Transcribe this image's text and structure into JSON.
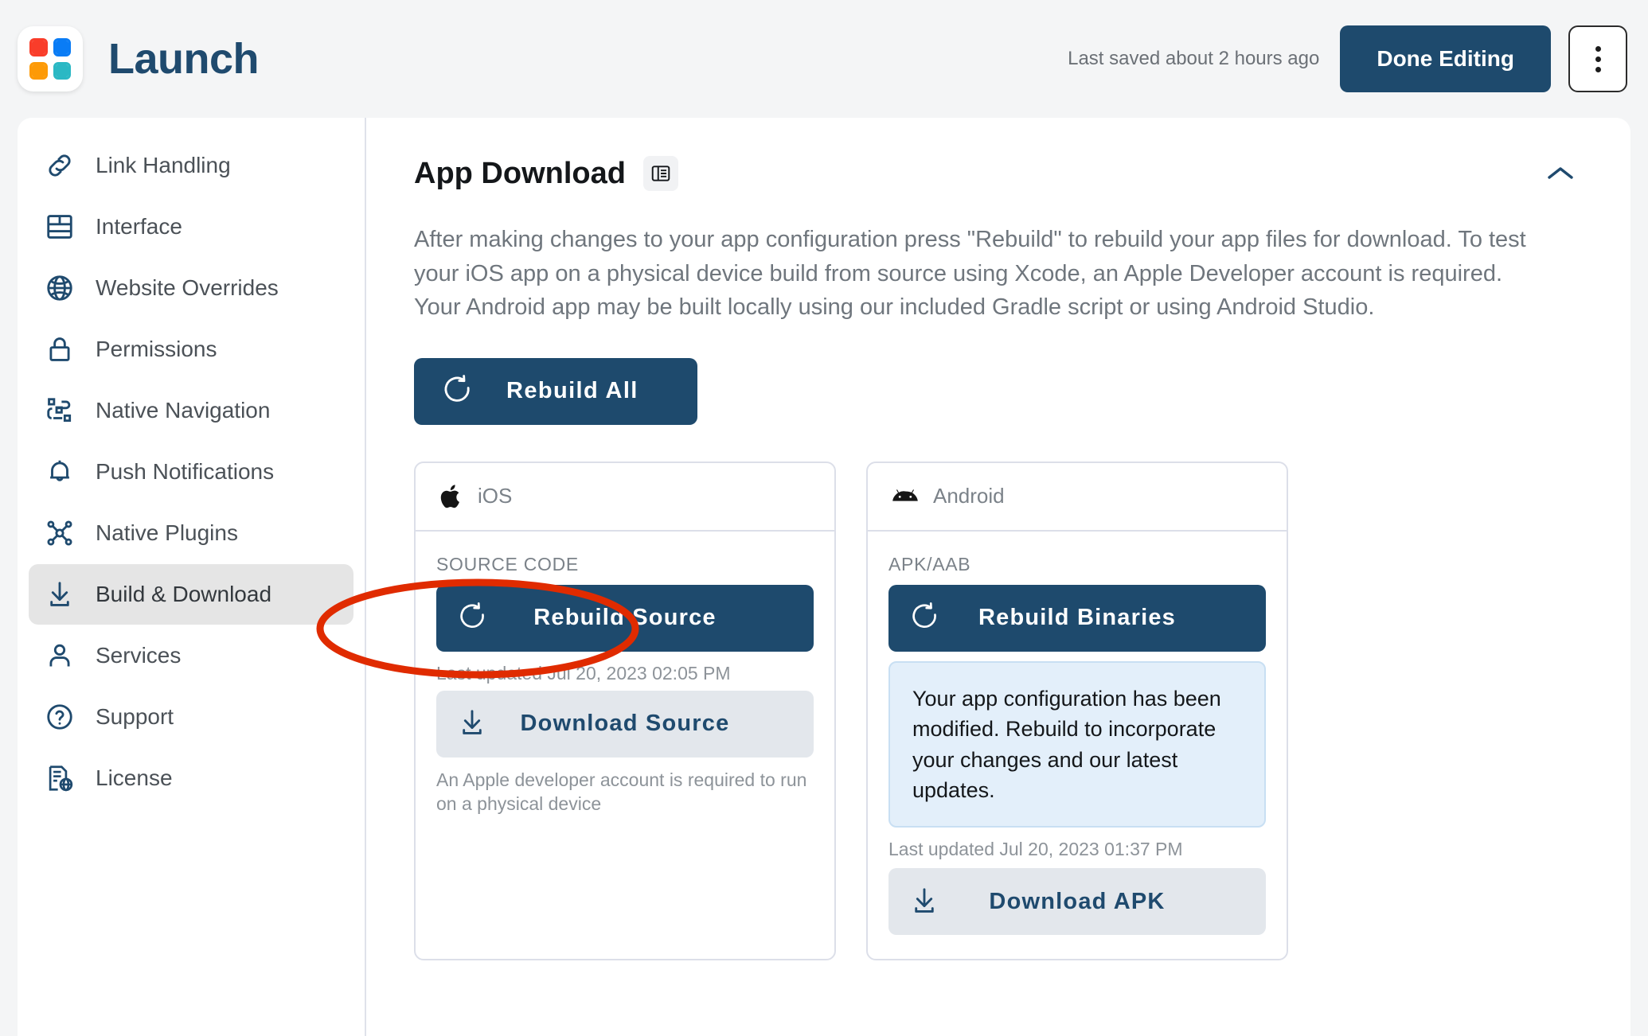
{
  "brand": {
    "name": "Launch",
    "logo_colors": [
      "#f93d2a",
      "#0a7cf5",
      "#fd9a07",
      "#2bb8c4"
    ]
  },
  "topbar": {
    "saved_status": "Last saved about 2 hours ago",
    "done_editing_label": "Done Editing",
    "overflow_menu_label": "More options"
  },
  "sidebar": {
    "items": [
      {
        "label": "Link Handling",
        "icon": "link-icon",
        "active": false
      },
      {
        "label": "Interface",
        "icon": "layout-icon",
        "active": false
      },
      {
        "label": "Website Overrides",
        "icon": "globe-icon",
        "active": false
      },
      {
        "label": "Permissions",
        "icon": "lock-icon",
        "active": false
      },
      {
        "label": "Native Navigation",
        "icon": "navigation-nodes-icon",
        "active": false
      },
      {
        "label": "Push Notifications",
        "icon": "bell-icon",
        "active": false
      },
      {
        "label": "Native Plugins",
        "icon": "plugins-nodes-icon",
        "active": false
      },
      {
        "label": "Build & Download",
        "icon": "download-icon",
        "active": true
      },
      {
        "label": "Services",
        "icon": "user-icon",
        "active": false
      },
      {
        "label": "Support",
        "icon": "question-circle-icon",
        "active": false
      },
      {
        "label": "License",
        "icon": "license-document-icon",
        "active": false
      }
    ]
  },
  "section": {
    "title": "App Download",
    "doc_icon": "panel-docs-icon",
    "collapse_icon": "chevron-up-icon",
    "description": "After making changes to your app configuration press \"Rebuild\" to rebuild your app files for download. To test your iOS app on a physical device build from source using Xcode, an Apple Developer account is required. Your Android app may be built locally using our included Gradle script or using Android Studio.",
    "rebuild_all_label": "Rebuild All",
    "rebuild_all_icon": "refresh-icon"
  },
  "platforms": {
    "ios": {
      "name": "iOS",
      "icon": "apple-icon",
      "field_label": "SOURCE CODE",
      "rebuild_label": "Rebuild Source",
      "rebuild_icon": "refresh-icon",
      "last_updated": "Last updated Jul 20, 2023 02:05 PM",
      "download_label": "Download Source",
      "download_icon": "download-icon",
      "hint": "An Apple developer account is required to run on a physical device"
    },
    "android": {
      "name": "Android",
      "icon": "android-icon",
      "field_label": "APK/AAB",
      "rebuild_label": "Rebuild Binaries",
      "rebuild_icon": "refresh-icon",
      "notice": "Your app configuration has been modified. Rebuild to incorporate your changes and our latest updates.",
      "last_updated": "Last updated Jul 20, 2023 01:37 PM",
      "download_label": "Download APK",
      "download_icon": "download-icon"
    }
  },
  "annotation": {
    "shape": "ellipse",
    "color": "#e02b00",
    "target": "Download Source"
  },
  "colors": {
    "primary": "#1e4a6d",
    "panel_bg": "#ffffff",
    "page_bg": "#f4f5f6",
    "active_nav_bg": "#e5e5e5",
    "notice_bg": "#e3effa",
    "annotation_red": "#e02b00"
  }
}
